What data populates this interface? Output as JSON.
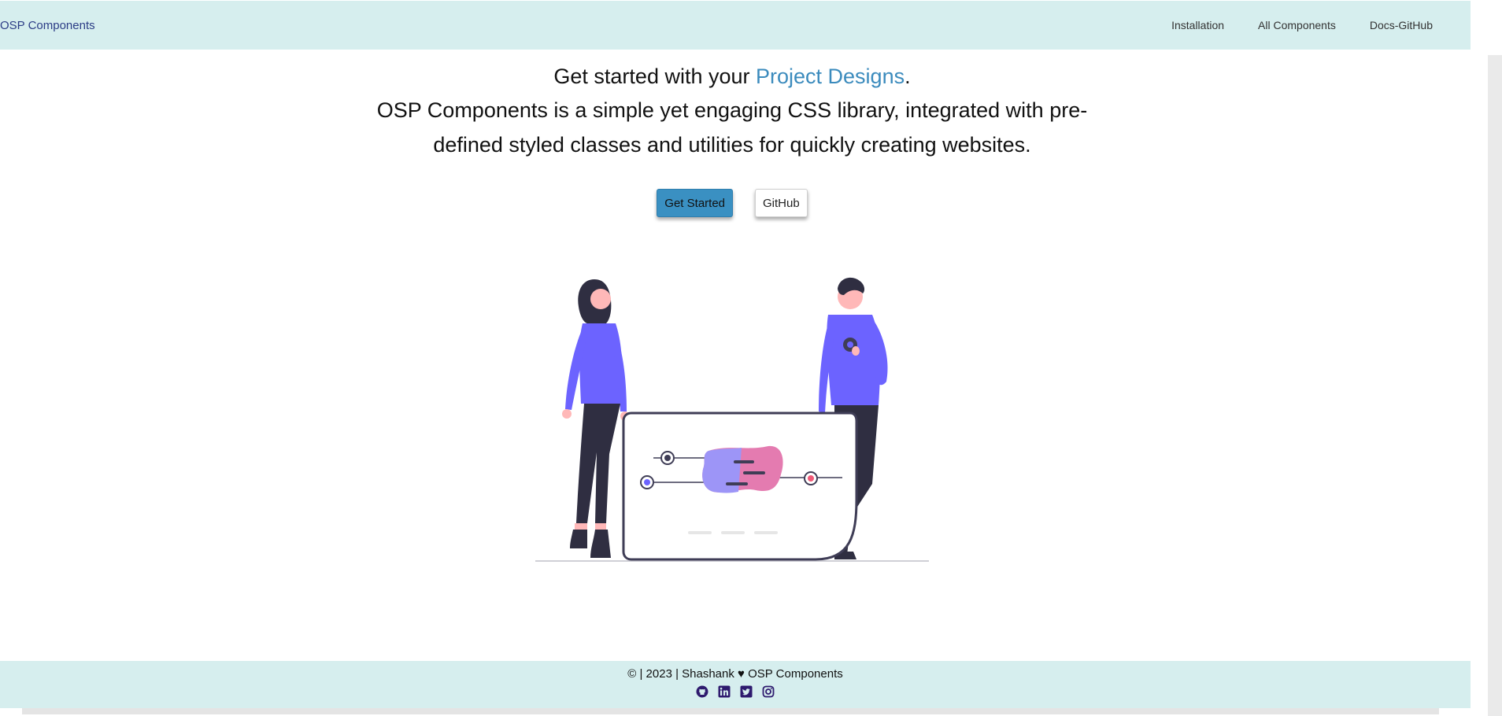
{
  "navbar": {
    "brand": "OSP Components",
    "links": [
      "Installation",
      "All Components",
      "Docs-GitHub"
    ]
  },
  "hero": {
    "line1_prefix": "Get started with your ",
    "line1_accent": "Project Designs",
    "line1_suffix": ".",
    "description": "OSP Components is a simple yet engaging CSS library, integrated with pre-defined styled classes and utilities for quickly creating websites."
  },
  "buttons": {
    "get_started": "Get Started",
    "github": "GitHub"
  },
  "footer": {
    "text": "© | 2023 | Shashank ♥ OSP Components",
    "icons": [
      "github-icon",
      "linkedin-icon",
      "twitter-icon",
      "instagram-icon"
    ]
  },
  "colors": {
    "nav_bg": "#d6eeee",
    "brand": "#2c3d86",
    "accent": "#3b8bbd",
    "primary_button": "#3a90c2",
    "figure_purple": "#6c63ff",
    "icon_color": "#2e1a6e"
  }
}
